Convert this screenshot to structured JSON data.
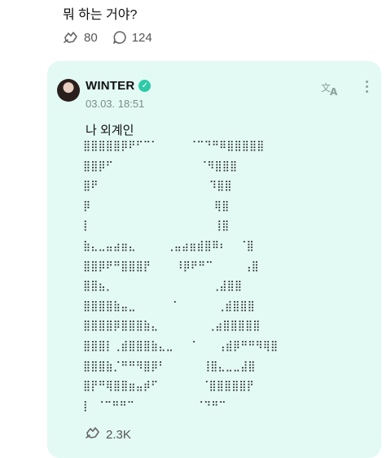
{
  "previous_post": {
    "text": "뭐 하는 거야?",
    "reaction_count": "80",
    "comment_count": "124"
  },
  "post": {
    "author": "WINTER",
    "date": "03.03. 18:51",
    "text": "나 외계인",
    "art_lines": [
      "⣿⣿⣿⣿⣿⡿⠟⠋⠉⠁     ⠈⠉⠙⠛⠿⣿⣿⣿⣿⣿",
      "⣿⣿⡿⠋              ⠈⠻⣿⣿⣿",
      "⣿⠟                  ⠹⣿⣿",
      "⡿                    ⢿⣿",
      "⡇                    ⢸⣿",
      "⣷⣄⣀⣤⣴⣶⣄     ⢀⣤⣴⣶⣾⣿⠿⠆  ⠈⣿",
      "⣿⣿⡿⠟⠛⣿⣿⣿⡟    ⠸⡿⠟⠛⠉     ⢠⣿",
      "⣿⣿⣦⡀                ⢀⣼⣿⣿",
      "⣿⣿⣿⣿⣷⣤⣀      ⠁      ⢀⣾⣿⣿⣿",
      "⣿⣿⣿⣿⡿⣿⣿⣿⣷⣄        ⢀⣴⣿⣿⣿⣿⣿",
      "⣿⣿⣿⡇⢀⣾⣿⣿⣿⣷⣄⣀   ⠁   ⢠⣾⡿⠛⠛⠻⢿⣿",
      "⣿⣿⣿⣷⡈⠛⠛⠻⣿⡿⠃      ⢸⣿⣄⣀⣀⣼⣿",
      "⣿⡟⠛⢿⣿⣿⣶⣤⡾⠋       ⠈⣿⣿⣿⣿⣿⡟",
      "⡇ ⠈⠉⠛⠛⠉          ⠈⠙⠛⠉"
    ],
    "reaction_count": "2.3K",
    "colors": {
      "card_background": "#e3faf4",
      "verified": "#2fc9a7"
    }
  }
}
